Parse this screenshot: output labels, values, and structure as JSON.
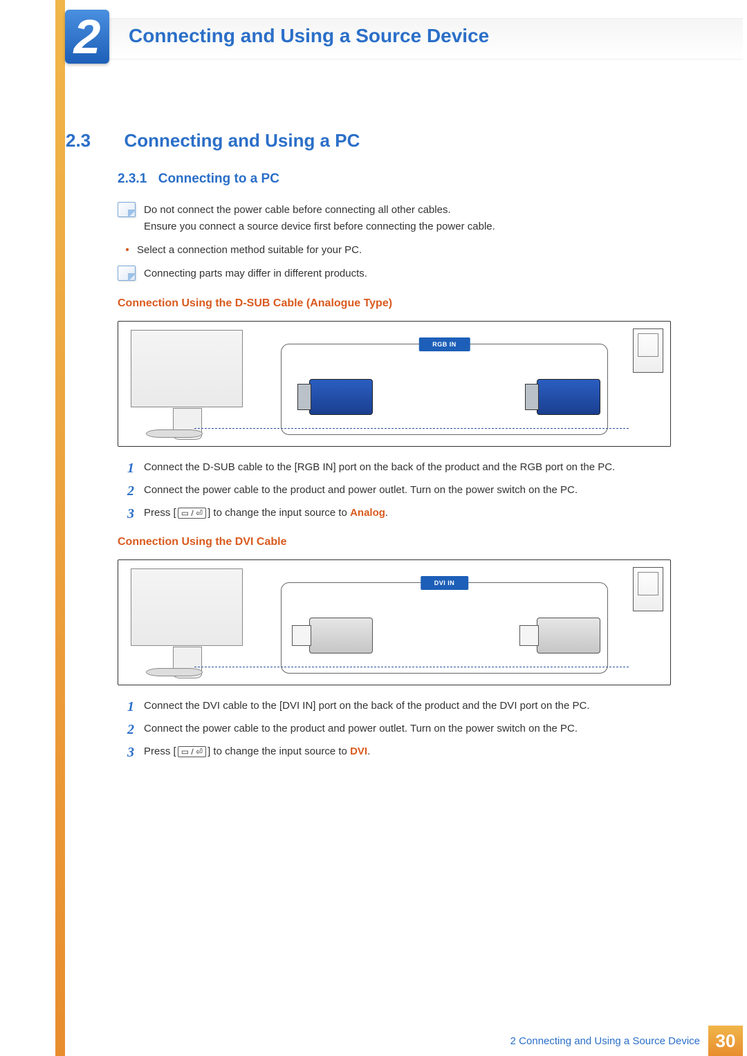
{
  "chapter": {
    "num": "2",
    "title": "Connecting and Using a Source Device"
  },
  "section": {
    "num": "2.3",
    "title": "Connecting and Using a PC"
  },
  "subsection": {
    "num": "2.3.1",
    "title": "Connecting to a PC"
  },
  "note1": {
    "line1": "Do not connect the power cable before connecting all other cables.",
    "line2": "Ensure you connect a source device first before connecting the power cable."
  },
  "bullet1": "Select a connection method suitable for your PC.",
  "note2": "Connecting parts may differ in different products.",
  "dsub": {
    "heading": "Connection Using the D-SUB Cable (Analogue Type)",
    "port_label": "RGB IN",
    "steps": {
      "s1": "Connect the D-SUB cable to the [RGB IN] port on the back of the product and the RGB port on the PC.",
      "s2": "Connect the power cable to the product and power outlet. Turn on the power switch on the PC.",
      "s3a": "Press [",
      "s3b": "] to change the input source to ",
      "s3kw": "Analog",
      "s3c": "."
    }
  },
  "dvi": {
    "heading": "Connection Using the DVI Cable",
    "port_label": "DVI IN",
    "steps": {
      "s1": "Connect the DVI cable to the [DVI IN] port on the back of the product and the DVI port on the PC.",
      "s2": "Connect the power cable to the product and power outlet. Turn on the power switch on the PC.",
      "s3a": "Press [",
      "s3b": "] to change the input source to ",
      "s3kw": "DVI",
      "s3c": "."
    }
  },
  "footer": {
    "label_prefix": "2 ",
    "label": "Connecting and Using a Source Device",
    "page": "30"
  }
}
